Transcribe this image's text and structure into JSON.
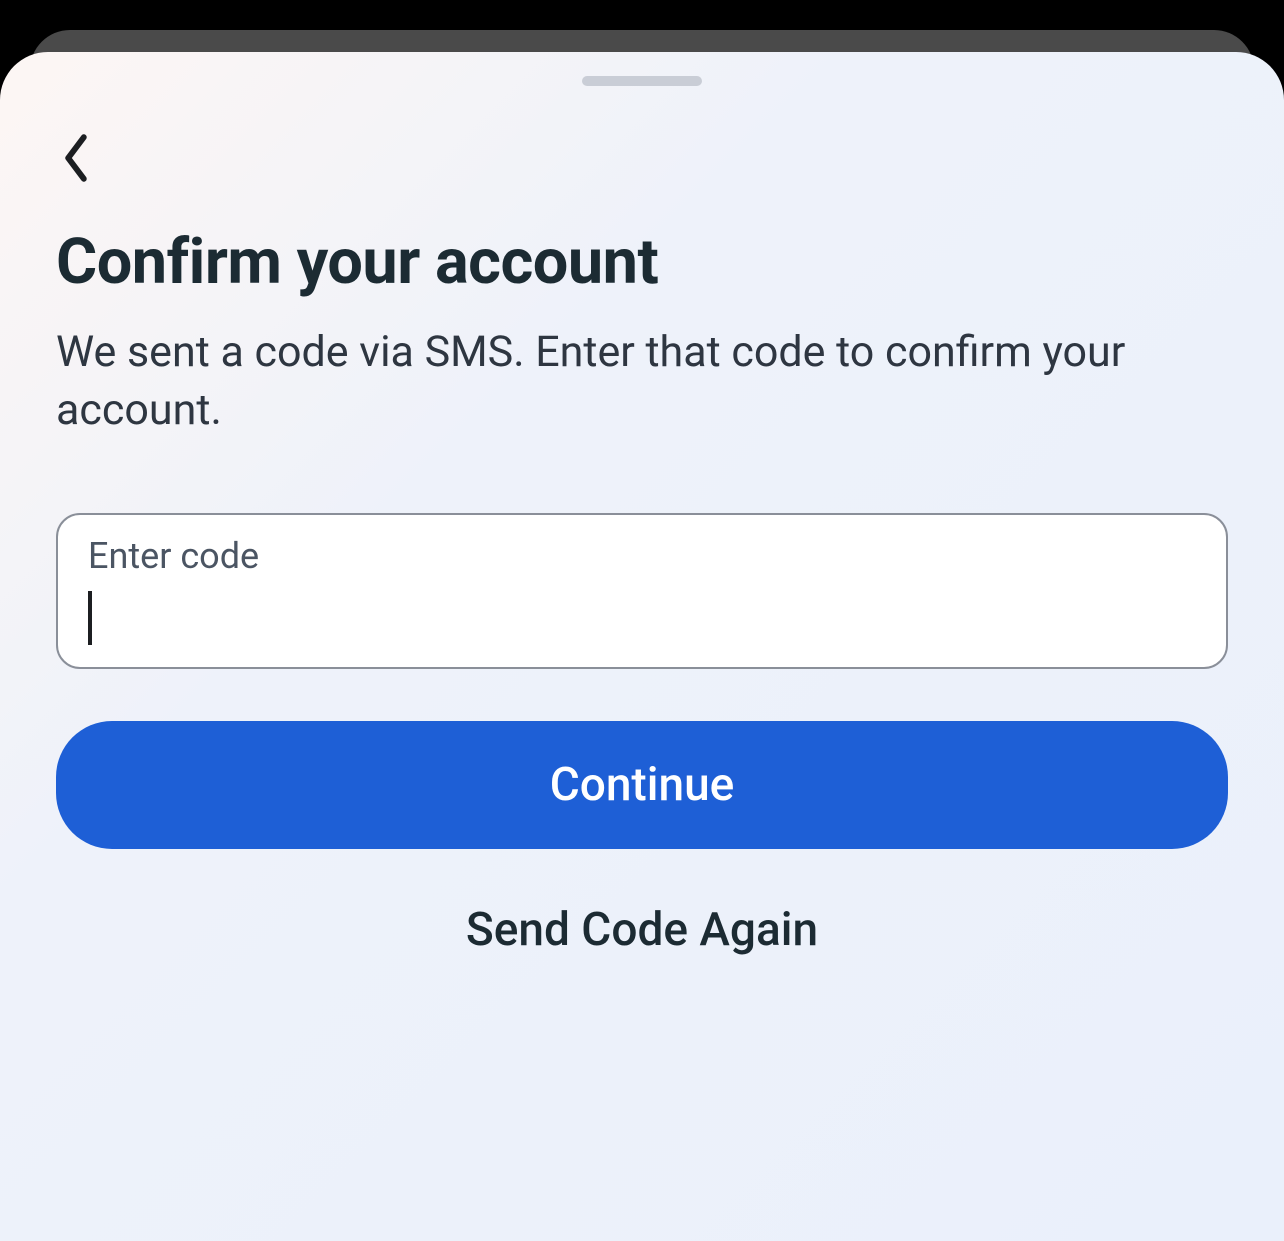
{
  "header": {
    "title": "Confirm your account",
    "subtitle": "We sent a code via SMS. Enter that code to confirm your account."
  },
  "form": {
    "code_label": "Enter code",
    "code_value": ""
  },
  "actions": {
    "continue_label": "Continue",
    "resend_label": "Send Code Again"
  }
}
